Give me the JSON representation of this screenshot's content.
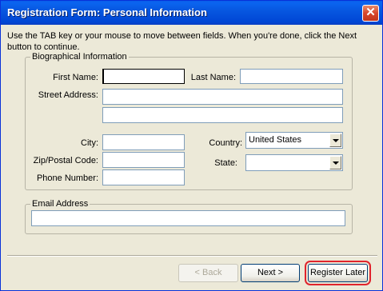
{
  "window": {
    "title": "Registration Form: Personal Information",
    "close_glyph": "✕"
  },
  "intro": "Use the TAB key or your mouse to move between fields.  When you're done, click the Next button to continue.",
  "bio": {
    "legend": "Biographical Information",
    "first_name_label": "First Name:",
    "first_name_value": "",
    "last_name_label": "Last Name:",
    "last_name_value": "",
    "street_label": "Street Address:",
    "street_line1_value": "",
    "street_line2_value": "",
    "city_label": "City:",
    "city_value": "",
    "country_label": "Country:",
    "country_value": "United States",
    "zip_label": "Zip/Postal Code:",
    "zip_value": "",
    "state_label": "State:",
    "state_value": "",
    "phone_label": "Phone Number:",
    "phone_value": ""
  },
  "email": {
    "legend": "Email Address",
    "value": ""
  },
  "buttons": {
    "back": "< Back",
    "next": "Next >",
    "register_later": "Register Later"
  },
  "colors": {
    "titlebar": "#0054e3",
    "window_bg": "#ece9d8",
    "highlight": "#e0232c"
  }
}
